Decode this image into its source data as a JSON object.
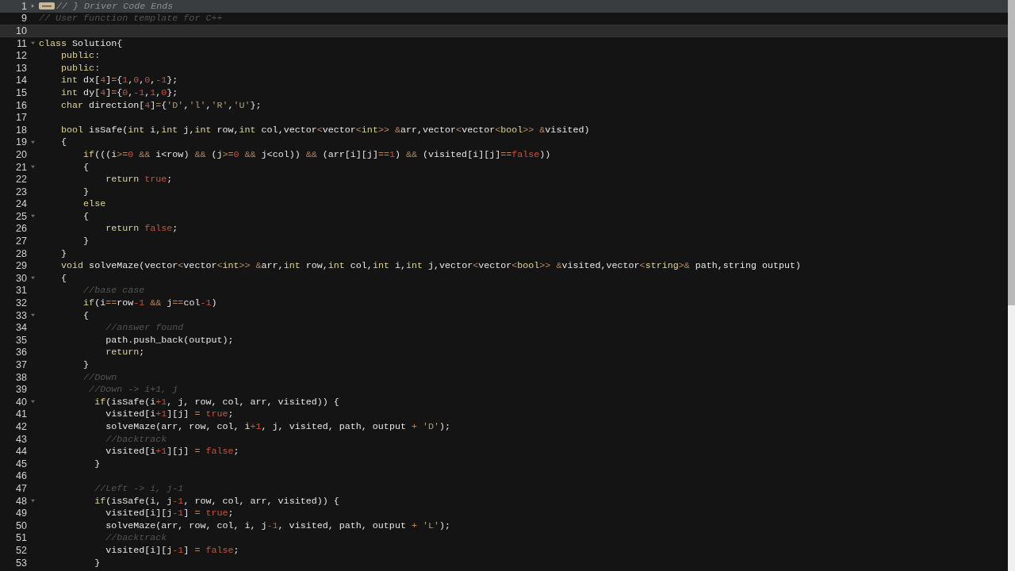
{
  "editor": {
    "lines": [
      {
        "number": "1",
        "foldable": true,
        "collapsed": true,
        "current": false,
        "tokens": [
          {
            "kind": "comment",
            "text": "// } Driver Code Ends"
          }
        ]
      },
      {
        "number": "9",
        "foldable": false,
        "current": false,
        "tokens": [
          {
            "kind": "comment",
            "text": "// User function template for C++"
          }
        ]
      },
      {
        "number": "10",
        "foldable": false,
        "current": true
      },
      {
        "number": "11",
        "foldable": true,
        "collapsed": false,
        "current": false,
        "tokens": [
          {
            "kind": "keyword",
            "text": "class"
          },
          {
            "kind": "plain",
            "text": " Solution{"
          }
        ]
      },
      {
        "number": "12",
        "foldable": false,
        "current": false,
        "tokens": [
          {
            "kind": "keyword",
            "text": "    public:"
          }
        ]
      },
      {
        "number": "13",
        "foldable": false,
        "current": false,
        "tokens": [
          {
            "kind": "keyword",
            "text": "    public:"
          }
        ]
      },
      {
        "number": "14",
        "foldable": false,
        "current": false,
        "tokens": [
          {
            "kind": "keyword",
            "text": "    int"
          },
          {
            "kind": "plain",
            "text": " dx["
          },
          {
            "kind": "number",
            "text": "4"
          },
          {
            "kind": "plain",
            "text": "]"
          },
          {
            "kind": "operator",
            "text": "="
          },
          {
            "kind": "plain",
            "text": "{"
          },
          {
            "kind": "number",
            "text": "1"
          },
          {
            "kind": "plain",
            "text": ","
          },
          {
            "kind": "number",
            "text": "0"
          },
          {
            "kind": "plain",
            "text": ","
          },
          {
            "kind": "number",
            "text": "0"
          },
          {
            "kind": "plain",
            "text": ","
          },
          {
            "kind": "number",
            "text": "-1"
          },
          {
            "kind": "plain",
            "text": "};"
          }
        ]
      },
      {
        "number": "15",
        "foldable": false,
        "current": false,
        "tokens": [
          {
            "kind": "keyword",
            "text": "    int"
          },
          {
            "kind": "plain",
            "text": " dy["
          },
          {
            "kind": "number",
            "text": "4"
          },
          {
            "kind": "plain",
            "text": "]"
          },
          {
            "kind": "operator",
            "text": "="
          },
          {
            "kind": "plain",
            "text": "{"
          },
          {
            "kind": "number",
            "text": "0"
          },
          {
            "kind": "plain",
            "text": ","
          },
          {
            "kind": "number",
            "text": "-1"
          },
          {
            "kind": "plain",
            "text": ","
          },
          {
            "kind": "number",
            "text": "1"
          },
          {
            "kind": "plain",
            "text": ","
          },
          {
            "kind": "number",
            "text": "0"
          },
          {
            "kind": "plain",
            "text": "};"
          }
        ]
      },
      {
        "number": "16",
        "foldable": false,
        "current": false,
        "tokens": [
          {
            "kind": "keyword",
            "text": "    char"
          },
          {
            "kind": "plain",
            "text": " direction["
          },
          {
            "kind": "number",
            "text": "4"
          },
          {
            "kind": "plain",
            "text": "]"
          },
          {
            "kind": "operator",
            "text": "="
          },
          {
            "kind": "plain",
            "text": "{"
          },
          {
            "kind": "string",
            "text": "'D'"
          },
          {
            "kind": "plain",
            "text": ","
          },
          {
            "kind": "string",
            "text": "'l'"
          },
          {
            "kind": "plain",
            "text": ","
          },
          {
            "kind": "string",
            "text": "'R'"
          },
          {
            "kind": "plain",
            "text": ","
          },
          {
            "kind": "string",
            "text": "'U'"
          },
          {
            "kind": "plain",
            "text": "};"
          }
        ]
      },
      {
        "number": "17",
        "foldable": false,
        "current": false
      },
      {
        "number": "18",
        "foldable": false,
        "current": false,
        "tokens": [
          {
            "kind": "keyword",
            "text": "    bool"
          },
          {
            "kind": "plain",
            "text": " isSafe("
          },
          {
            "kind": "keyword",
            "text": "int"
          },
          {
            "kind": "plain",
            "text": " i,"
          },
          {
            "kind": "keyword",
            "text": "int"
          },
          {
            "kind": "plain",
            "text": " j,"
          },
          {
            "kind": "keyword",
            "text": "int"
          },
          {
            "kind": "plain",
            "text": " row,"
          },
          {
            "kind": "keyword",
            "text": "int"
          },
          {
            "kind": "plain",
            "text": " col,vector"
          },
          {
            "kind": "operator",
            "text": "<"
          },
          {
            "kind": "plain",
            "text": "vector"
          },
          {
            "kind": "operator",
            "text": "<"
          },
          {
            "kind": "keyword",
            "text": "int"
          },
          {
            "kind": "operator",
            "text": ">> &"
          },
          {
            "kind": "plain",
            "text": "arr,vector"
          },
          {
            "kind": "operator",
            "text": "<"
          },
          {
            "kind": "plain",
            "text": "vector"
          },
          {
            "kind": "operator",
            "text": "<"
          },
          {
            "kind": "keyword",
            "text": "bool"
          },
          {
            "kind": "operator",
            "text": ">> &"
          },
          {
            "kind": "plain",
            "text": "visited)"
          }
        ]
      },
      {
        "number": "19",
        "foldable": true,
        "collapsed": false,
        "current": false,
        "tokens": [
          {
            "kind": "plain",
            "text": "    {"
          }
        ]
      },
      {
        "number": "20",
        "foldable": false,
        "current": false,
        "tokens": [
          {
            "kind": "keyword",
            "text": "        if"
          },
          {
            "kind": "plain",
            "text": "(((i"
          },
          {
            "kind": "operator",
            "text": ">="
          },
          {
            "kind": "number",
            "text": "0"
          },
          {
            "kind": "operator",
            "text": " && "
          },
          {
            "kind": "plain",
            "text": "i<row) "
          },
          {
            "kind": "operator",
            "text": "&&"
          },
          {
            "kind": "plain",
            "text": " (j"
          },
          {
            "kind": "operator",
            "text": ">="
          },
          {
            "kind": "number",
            "text": "0"
          },
          {
            "kind": "operator",
            "text": " && "
          },
          {
            "kind": "plain",
            "text": "j<col)) "
          },
          {
            "kind": "operator",
            "text": "&&"
          },
          {
            "kind": "plain",
            "text": " (arr[i][j]"
          },
          {
            "kind": "operator",
            "text": "=="
          },
          {
            "kind": "number",
            "text": "1"
          },
          {
            "kind": "plain",
            "text": ") "
          },
          {
            "kind": "operator",
            "text": "&&"
          },
          {
            "kind": "plain",
            "text": " (visited[i][j]"
          },
          {
            "kind": "operator",
            "text": "=="
          },
          {
            "kind": "literal",
            "text": "false"
          },
          {
            "kind": "plain",
            "text": "))"
          }
        ]
      },
      {
        "number": "21",
        "foldable": true,
        "collapsed": false,
        "current": false,
        "tokens": [
          {
            "kind": "plain",
            "text": "        {"
          }
        ]
      },
      {
        "number": "22",
        "foldable": false,
        "current": false,
        "tokens": [
          {
            "kind": "keyword",
            "text": "            return"
          },
          {
            "kind": "literal",
            "text": " true"
          },
          {
            "kind": "plain",
            "text": ";"
          }
        ]
      },
      {
        "number": "23",
        "foldable": false,
        "current": false,
        "tokens": [
          {
            "kind": "plain",
            "text": "        }"
          }
        ]
      },
      {
        "number": "24",
        "foldable": false,
        "current": false,
        "tokens": [
          {
            "kind": "keyword",
            "text": "        else"
          }
        ]
      },
      {
        "number": "25",
        "foldable": true,
        "collapsed": false,
        "current": false,
        "tokens": [
          {
            "kind": "plain",
            "text": "        {"
          }
        ]
      },
      {
        "number": "26",
        "foldable": false,
        "current": false,
        "tokens": [
          {
            "kind": "keyword",
            "text": "            return"
          },
          {
            "kind": "literal",
            "text": " false"
          },
          {
            "kind": "plain",
            "text": ";"
          }
        ]
      },
      {
        "number": "27",
        "foldable": false,
        "current": false,
        "tokens": [
          {
            "kind": "plain",
            "text": "        }"
          }
        ]
      },
      {
        "number": "28",
        "foldable": false,
        "current": false,
        "tokens": [
          {
            "kind": "plain",
            "text": "    }"
          }
        ]
      },
      {
        "number": "29",
        "foldable": false,
        "current": false,
        "tokens": [
          {
            "kind": "keyword",
            "text": "    void"
          },
          {
            "kind": "plain",
            "text": " solveMaze(vector"
          },
          {
            "kind": "operator",
            "text": "<"
          },
          {
            "kind": "plain",
            "text": "vector"
          },
          {
            "kind": "operator",
            "text": "<"
          },
          {
            "kind": "keyword",
            "text": "int"
          },
          {
            "kind": "operator",
            "text": ">> &"
          },
          {
            "kind": "plain",
            "text": "arr,"
          },
          {
            "kind": "keyword",
            "text": "int"
          },
          {
            "kind": "plain",
            "text": " row,"
          },
          {
            "kind": "keyword",
            "text": "int"
          },
          {
            "kind": "plain",
            "text": " col,"
          },
          {
            "kind": "keyword",
            "text": "int"
          },
          {
            "kind": "plain",
            "text": " i,"
          },
          {
            "kind": "keyword",
            "text": "int"
          },
          {
            "kind": "plain",
            "text": " j,vector"
          },
          {
            "kind": "operator",
            "text": "<"
          },
          {
            "kind": "plain",
            "text": "vector"
          },
          {
            "kind": "operator",
            "text": "<"
          },
          {
            "kind": "keyword",
            "text": "bool"
          },
          {
            "kind": "operator",
            "text": ">> &"
          },
          {
            "kind": "plain",
            "text": "visited,vector"
          },
          {
            "kind": "operator",
            "text": "<"
          },
          {
            "kind": "keyword",
            "text": "string"
          },
          {
            "kind": "operator",
            "text": ">&"
          },
          {
            "kind": "plain",
            "text": " path,string output)"
          }
        ]
      },
      {
        "number": "30",
        "foldable": true,
        "collapsed": false,
        "current": false,
        "tokens": [
          {
            "kind": "plain",
            "text": "    {"
          }
        ]
      },
      {
        "number": "31",
        "foldable": false,
        "current": false,
        "tokens": [
          {
            "kind": "comment",
            "text": "        //base case"
          }
        ]
      },
      {
        "number": "32",
        "foldable": false,
        "current": false,
        "tokens": [
          {
            "kind": "keyword",
            "text": "        if"
          },
          {
            "kind": "plain",
            "text": "(i"
          },
          {
            "kind": "operator",
            "text": "=="
          },
          {
            "kind": "plain",
            "text": "row"
          },
          {
            "kind": "number",
            "text": "-1"
          },
          {
            "kind": "operator",
            "text": " && "
          },
          {
            "kind": "plain",
            "text": "j"
          },
          {
            "kind": "operator",
            "text": "=="
          },
          {
            "kind": "plain",
            "text": "col"
          },
          {
            "kind": "number",
            "text": "-1"
          },
          {
            "kind": "plain",
            "text": ")"
          }
        ]
      },
      {
        "number": "33",
        "foldable": true,
        "collapsed": false,
        "current": false,
        "tokens": [
          {
            "kind": "plain",
            "text": "        {"
          }
        ]
      },
      {
        "number": "34",
        "foldable": false,
        "current": false,
        "tokens": [
          {
            "kind": "comment",
            "text": "            //answer found"
          }
        ]
      },
      {
        "number": "35",
        "foldable": false,
        "current": false,
        "tokens": [
          {
            "kind": "plain",
            "text": "            path.push_back(output);"
          }
        ]
      },
      {
        "number": "36",
        "foldable": false,
        "current": false,
        "tokens": [
          {
            "kind": "keyword",
            "text": "            return"
          },
          {
            "kind": "plain",
            "text": ";"
          }
        ]
      },
      {
        "number": "37",
        "foldable": false,
        "current": false,
        "tokens": [
          {
            "kind": "plain",
            "text": "        }"
          }
        ]
      },
      {
        "number": "38",
        "foldable": false,
        "current": false,
        "tokens": [
          {
            "kind": "comment",
            "text": "        //Down"
          }
        ]
      },
      {
        "number": "39",
        "foldable": false,
        "current": false,
        "tokens": [
          {
            "kind": "comment",
            "text": "         //Down -> i+1, j"
          }
        ]
      },
      {
        "number": "40",
        "foldable": true,
        "collapsed": false,
        "current": false,
        "tokens": [
          {
            "kind": "keyword",
            "text": "          if"
          },
          {
            "kind": "plain",
            "text": "(isSafe(i"
          },
          {
            "kind": "number",
            "text": "+1"
          },
          {
            "kind": "plain",
            "text": ", j, row, col, arr, visited)) {"
          }
        ]
      },
      {
        "number": "41",
        "foldable": false,
        "current": false,
        "tokens": [
          {
            "kind": "plain",
            "text": "            visited[i"
          },
          {
            "kind": "number",
            "text": "+1"
          },
          {
            "kind": "plain",
            "text": "][j] "
          },
          {
            "kind": "operator",
            "text": "="
          },
          {
            "kind": "literal",
            "text": " true"
          },
          {
            "kind": "plain",
            "text": ";"
          }
        ]
      },
      {
        "number": "42",
        "foldable": false,
        "current": false,
        "tokens": [
          {
            "kind": "plain",
            "text": "            solveMaze(arr, row, col, i"
          },
          {
            "kind": "number",
            "text": "+1"
          },
          {
            "kind": "plain",
            "text": ", j, visited, path, output "
          },
          {
            "kind": "operator",
            "text": "+"
          },
          {
            "kind": "string",
            "text": " 'D'"
          },
          {
            "kind": "plain",
            "text": ");"
          }
        ]
      },
      {
        "number": "43",
        "foldable": false,
        "current": false,
        "tokens": [
          {
            "kind": "comment",
            "text": "            //backtrack"
          }
        ]
      },
      {
        "number": "44",
        "foldable": false,
        "current": false,
        "tokens": [
          {
            "kind": "plain",
            "text": "            visited[i"
          },
          {
            "kind": "number",
            "text": "+1"
          },
          {
            "kind": "plain",
            "text": "][j] "
          },
          {
            "kind": "operator",
            "text": "="
          },
          {
            "kind": "literal",
            "text": " false"
          },
          {
            "kind": "plain",
            "text": ";"
          }
        ]
      },
      {
        "number": "45",
        "foldable": false,
        "current": false,
        "tokens": [
          {
            "kind": "plain",
            "text": "          }"
          }
        ]
      },
      {
        "number": "46",
        "foldable": false,
        "current": false
      },
      {
        "number": "47",
        "foldable": false,
        "current": false,
        "tokens": [
          {
            "kind": "comment",
            "text": "          //Left -> i, j-1"
          }
        ]
      },
      {
        "number": "48",
        "foldable": true,
        "collapsed": false,
        "current": false,
        "tokens": [
          {
            "kind": "keyword",
            "text": "          if"
          },
          {
            "kind": "plain",
            "text": "(isSafe(i, j"
          },
          {
            "kind": "number",
            "text": "-1"
          },
          {
            "kind": "plain",
            "text": ", row, col, arr, visited)) {"
          }
        ]
      },
      {
        "number": "49",
        "foldable": false,
        "current": false,
        "tokens": [
          {
            "kind": "plain",
            "text": "            visited[i][j"
          },
          {
            "kind": "number",
            "text": "-1"
          },
          {
            "kind": "plain",
            "text": "] "
          },
          {
            "kind": "operator",
            "text": "="
          },
          {
            "kind": "literal",
            "text": " true"
          },
          {
            "kind": "plain",
            "text": ";"
          }
        ]
      },
      {
        "number": "50",
        "foldable": false,
        "current": false,
        "tokens": [
          {
            "kind": "plain",
            "text": "            solveMaze(arr, row, col, i, j"
          },
          {
            "kind": "number",
            "text": "-1"
          },
          {
            "kind": "plain",
            "text": ", visited, path, output "
          },
          {
            "kind": "operator",
            "text": "+"
          },
          {
            "kind": "string",
            "text": " 'L'"
          },
          {
            "kind": "plain",
            "text": ");"
          }
        ]
      },
      {
        "number": "51",
        "foldable": false,
        "current": false,
        "tokens": [
          {
            "kind": "comment",
            "text": "            //backtrack"
          }
        ]
      },
      {
        "number": "52",
        "foldable": false,
        "current": false,
        "tokens": [
          {
            "kind": "plain",
            "text": "            visited[i][j"
          },
          {
            "kind": "number",
            "text": "-1"
          },
          {
            "kind": "plain",
            "text": "] "
          },
          {
            "kind": "operator",
            "text": "="
          },
          {
            "kind": "literal",
            "text": " false"
          },
          {
            "kind": "plain",
            "text": ";"
          }
        ]
      },
      {
        "number": "53",
        "foldable": false,
        "current": false,
        "tokens": [
          {
            "kind": "plain",
            "text": "          }"
          }
        ]
      }
    ]
  }
}
